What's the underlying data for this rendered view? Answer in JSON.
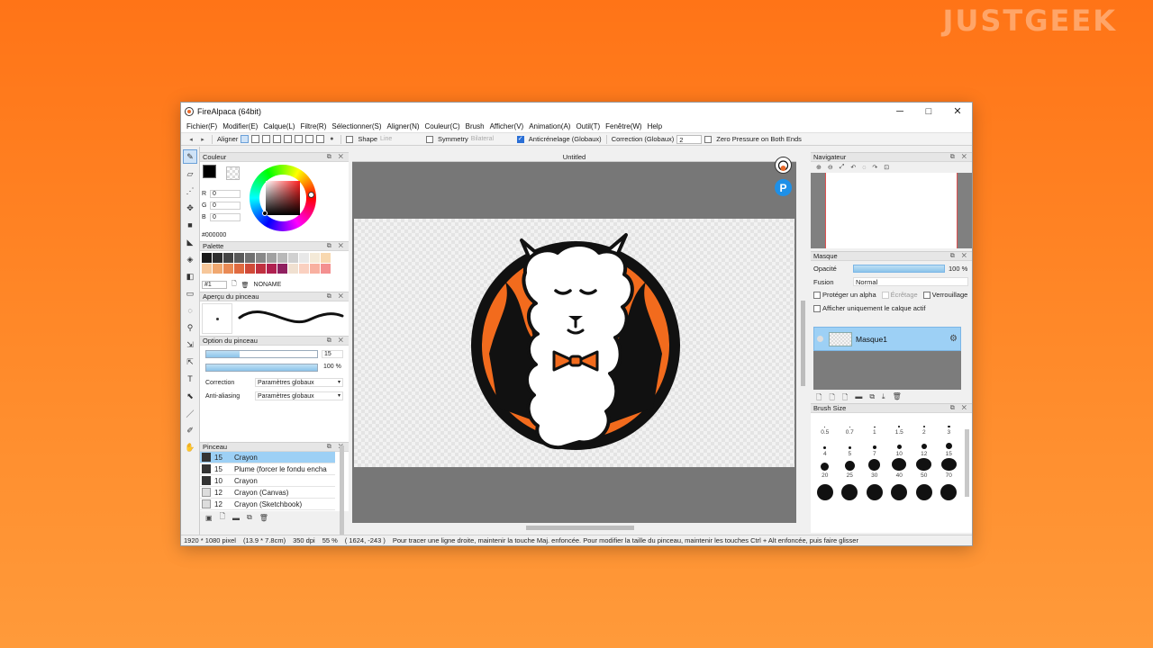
{
  "watermark": "JUSTGEEK",
  "window": {
    "title": "FireAlpaca (64bit)",
    "controls": [
      "─",
      "□",
      "✕"
    ]
  },
  "menu": [
    "Fichier(F)",
    "Modifier(E)",
    "Calque(L)",
    "Filtre(R)",
    "Sélectionner(S)",
    "Aligner(N)",
    "Couleur(C)",
    "Brush",
    "Afficher(V)",
    "Animation(A)",
    "Outil(T)",
    "Fenêtre(W)",
    "Help"
  ],
  "toolbar": {
    "aligner": "Aligner",
    "shape": "Shape",
    "shape_value": "Line",
    "symmetry": "Symmetry",
    "symmetry_value": "Bilateral",
    "antialias": "Anticrénelage (Globaux)",
    "correction": "Correction (Globaux)",
    "correction_value": "2",
    "zero_pressure": "Zero Pressure on Both Ends"
  },
  "panels": {
    "couleur": "Couleur",
    "palette": "Palette",
    "apercu": "Aperçu du pinceau",
    "option": "Option du pinceau",
    "pinceau": "Pinceau",
    "navigateur": "Navigateur",
    "masque": "Masque",
    "brush_size": "Brush Size",
    "panel_buttons": "⧉ ✕"
  },
  "color": {
    "r_label": "R",
    "g_label": "G",
    "b_label": "B",
    "r": "0",
    "g": "0",
    "b": "0",
    "hex": "#000000"
  },
  "palette": {
    "swatches": [
      "#1a1a1a",
      "#2e2e2e",
      "#444444",
      "#5a5a5a",
      "#707070",
      "#888888",
      "#a0a0a0",
      "#b8b8b8",
      "#d0d0d0",
      "#e8e8e8",
      "#f4ead8",
      "#f8d8b0",
      "#f6c79a",
      "#f0a870",
      "#e98a55",
      "#e06a40",
      "#d04a38",
      "#c03040",
      "#b02050",
      "#902060",
      "#f0e0d0",
      "#fad0c0",
      "#f8b0a0",
      "#f49090"
    ],
    "index": "#1",
    "name": "NONAME"
  },
  "brush_option": {
    "size_value": "15",
    "size_fill": 0.3,
    "opacity_value": "100 %",
    "opacity_fill": 1.0,
    "correction_label": "Correction",
    "correction_value": "Paramètres globaux",
    "antialias_label": "Anti-aliasing",
    "antialias_value": "Paramètres globaux"
  },
  "brushes": [
    {
      "size": "15",
      "name": "Crayon",
      "selected": true,
      "light": false
    },
    {
      "size": "15",
      "name": "Plume (forcer le fondu encha",
      "selected": false,
      "light": false
    },
    {
      "size": "10",
      "name": "Crayon",
      "selected": false,
      "light": false
    },
    {
      "size": "12",
      "name": "Crayon (Canvas)",
      "selected": false,
      "light": true
    },
    {
      "size": "12",
      "name": "Crayon (Sketchbook)",
      "selected": false,
      "light": true
    }
  ],
  "canvas": {
    "tab": "Untitled"
  },
  "navigator_tools": [
    "⊕",
    "⊖",
    "⤢",
    "↶",
    "◌",
    "↷",
    "⊡"
  ],
  "mask": {
    "opacity_label": "Opacité",
    "opacity_value": "100 %",
    "fusion_label": "Fusion",
    "fusion_value": "Normal",
    "protect_alpha": "Protéger un alpha",
    "clipping": "Écrêtage",
    "lock": "Verrouillage",
    "show_active": "Afficher uniquement le calque actif",
    "layer_name": "Masque1"
  },
  "brush_sizes": [
    {
      "n": "0.5",
      "d": 1
    },
    {
      "n": "0.7",
      "d": 1
    },
    {
      "n": "1",
      "d": 1.5
    },
    {
      "n": "1.5",
      "d": 1.8
    },
    {
      "n": "2",
      "d": 2
    },
    {
      "n": "3",
      "d": 2.5
    },
    {
      "n": "4",
      "d": 3
    },
    {
      "n": "5",
      "d": 3.5
    },
    {
      "n": "7",
      "d": 4.5
    },
    {
      "n": "10",
      "d": 5.5
    },
    {
      "n": "12",
      "d": 6.5
    },
    {
      "n": "15",
      "d": 7.5
    },
    {
      "n": "20",
      "d": 9
    },
    {
      "n": "25",
      "d": 11
    },
    {
      "n": "30",
      "d": 13
    },
    {
      "n": "40",
      "d": 16
    },
    {
      "n": "50",
      "d": 17
    },
    {
      "n": "70",
      "d": 17
    },
    {
      "n": "",
      "d": 18
    },
    {
      "n": "",
      "d": 18
    },
    {
      "n": "",
      "d": 18
    },
    {
      "n": "",
      "d": 18
    },
    {
      "n": "",
      "d": 18
    },
    {
      "n": "",
      "d": 18
    }
  ],
  "status": {
    "size": "1920 * 1080 pixel",
    "cm": "(13.9 * 7.8cm)",
    "dpi": "350 dpi",
    "zoom": "55 %",
    "coords": "( 1624, -243 )",
    "hint": "Pour tracer une ligne droite, maintenir la touche Maj. enfoncée. Pour modifier la taille du pinceau, maintenir les touches Ctrl + Alt enfoncée, puis faire glisser"
  }
}
